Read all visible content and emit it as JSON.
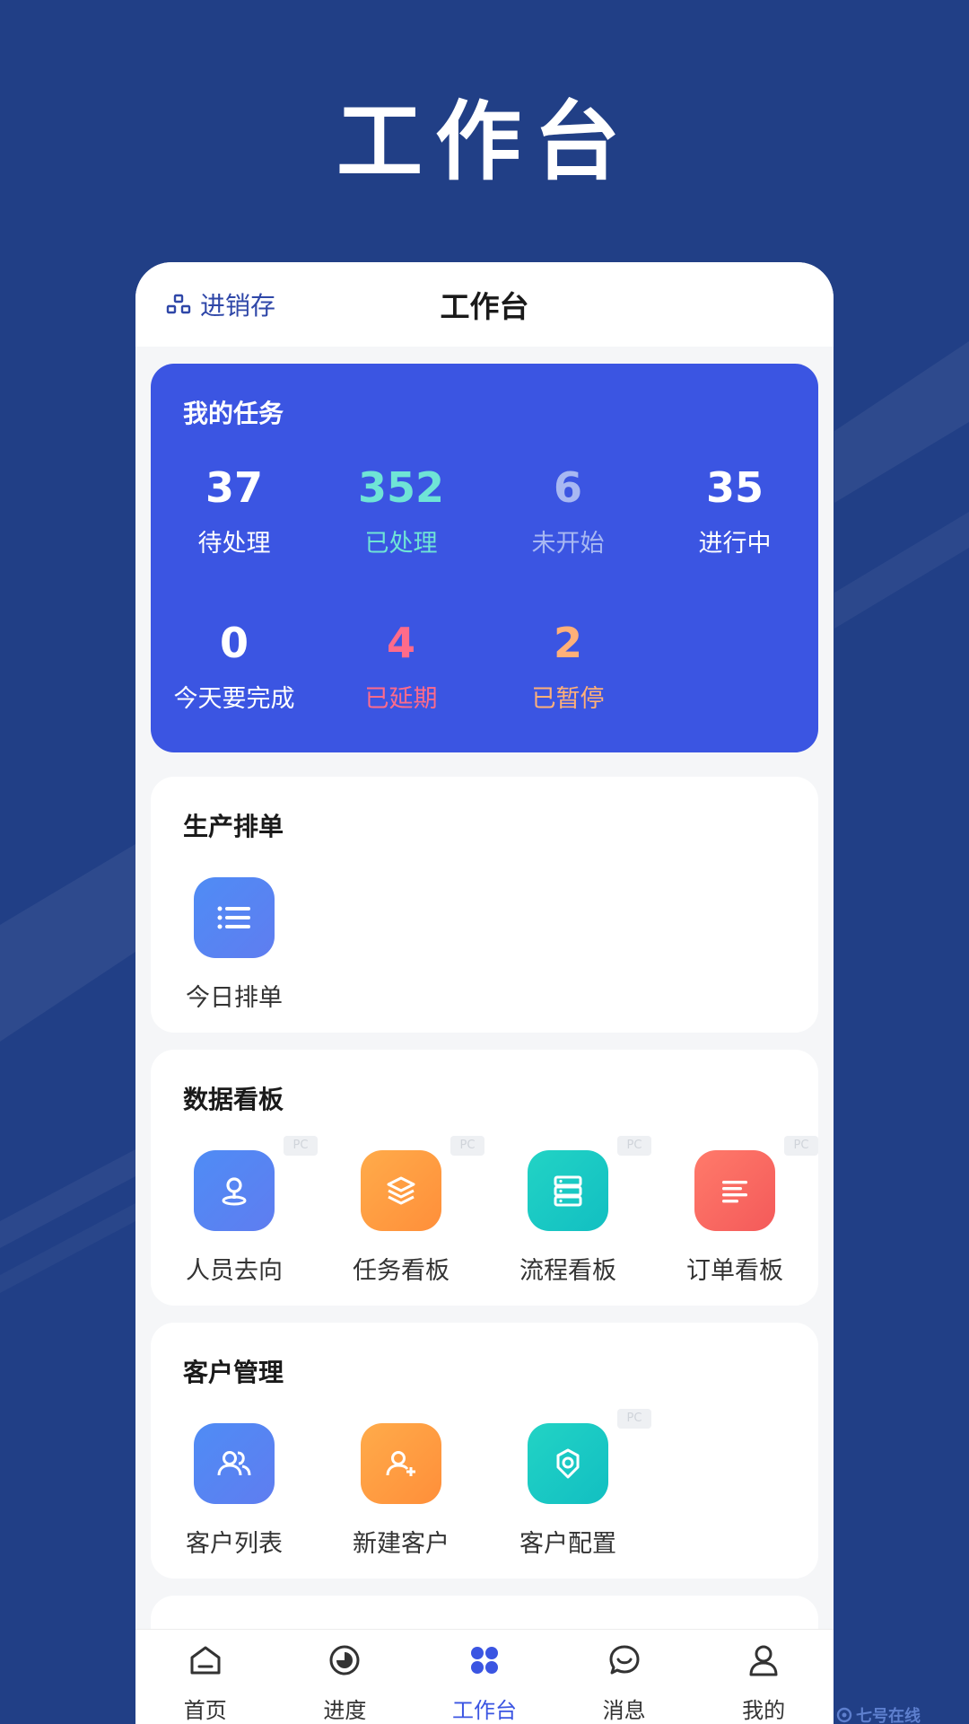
{
  "hero_title": "工作台",
  "header": {
    "left_label": "进销存",
    "title": "工作台"
  },
  "my_tasks": {
    "title": "我的任务",
    "stats": [
      {
        "value": "37",
        "label": "待处理",
        "color": "#ffffff"
      },
      {
        "value": "352",
        "label": "已处理",
        "color": "#6fe4d6"
      },
      {
        "value": "6",
        "label": "未开始",
        "color": "#a8b8f2"
      },
      {
        "value": "35",
        "label": "进行中",
        "color": "#ffffff"
      },
      {
        "value": "0",
        "label": "今天要完成",
        "color": "#ffffff"
      },
      {
        "value": "4",
        "label": "已延期",
        "color": "#ff6b8a"
      },
      {
        "value": "2",
        "label": "已暂停",
        "color": "#ffb078"
      }
    ]
  },
  "sections": {
    "production": {
      "title": "生产排单",
      "items": [
        {
          "label": "今日排单",
          "icon": "list-icon"
        }
      ]
    },
    "dashboard": {
      "title": "数据看板",
      "items": [
        {
          "label": "人员去向",
          "icon": "location-pin-icon",
          "badge": "PC"
        },
        {
          "label": "任务看板",
          "icon": "layers-icon",
          "badge": "PC"
        },
        {
          "label": "流程看板",
          "icon": "server-icon",
          "badge": "PC"
        },
        {
          "label": "订单看板",
          "icon": "document-lines-icon",
          "badge": "PC"
        }
      ]
    },
    "customer": {
      "title": "客户管理",
      "items": [
        {
          "label": "客户列表",
          "icon": "users-icon"
        },
        {
          "label": "新建客户",
          "icon": "user-add-icon"
        },
        {
          "label": "客户配置",
          "icon": "gear-icon",
          "badge": "PC"
        }
      ]
    }
  },
  "tabbar": {
    "items": [
      {
        "label": "首页",
        "icon": "home-icon"
      },
      {
        "label": "进度",
        "icon": "progress-icon"
      },
      {
        "label": "工作台",
        "icon": "grid-icon",
        "active": true
      },
      {
        "label": "消息",
        "icon": "chat-icon"
      },
      {
        "label": "我的",
        "icon": "user-icon"
      }
    ]
  },
  "watermark": "七号在线",
  "colors": {
    "background": "#213f86",
    "primary": "#3b55e2",
    "card": "#ffffff"
  }
}
